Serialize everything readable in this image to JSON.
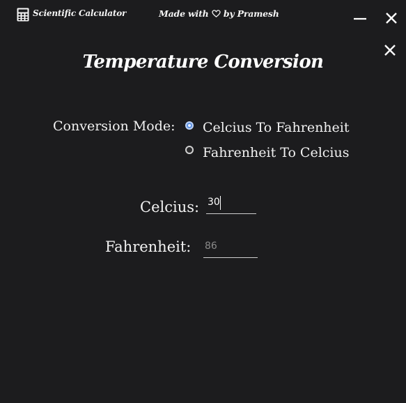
{
  "titlebar": {
    "app_title": "Scientific Calculator",
    "credit_prefix": "Made with",
    "credit_suffix": "by Pramesh",
    "icons": [
      "calculator-icon",
      "heart-icon",
      "minimize-icon",
      "close-icon"
    ]
  },
  "heading": "Temperature Conversion",
  "mode": {
    "label": "Conversion Mode:",
    "options": [
      {
        "label": "Celcius To Fahrenheit",
        "checked": true
      },
      {
        "label": "Fahrenheit To Celcius",
        "checked": false
      }
    ]
  },
  "fields": {
    "celcius": {
      "label": "Celcius:",
      "value": "30"
    },
    "fahrenheit": {
      "label": "Fahrenheit:",
      "value": "86"
    }
  },
  "colors": {
    "background": "#1c1c1e",
    "text": "#f2f2f2",
    "radio_accent": "#5b8fe0",
    "disabled_text": "#8a8a8a"
  }
}
